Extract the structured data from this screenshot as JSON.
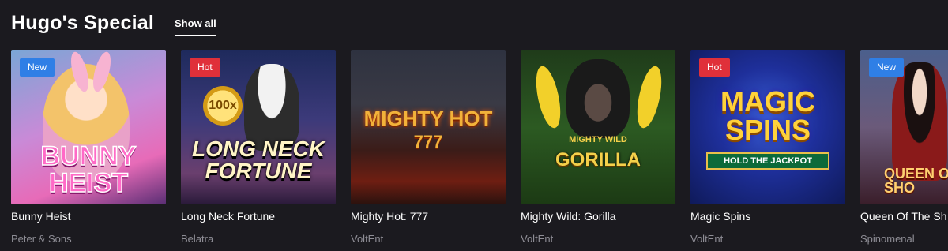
{
  "section": {
    "title": "Hugo's Special",
    "show_all_label": "Show all"
  },
  "games": [
    {
      "name": "Bunny Heist",
      "provider": "Peter & Sons",
      "badge": "New",
      "logo": "BUNNY HEIST"
    },
    {
      "name": "Long Neck Fortune",
      "provider": "Belatra",
      "badge": "Hot",
      "logo": "LONG NECK FORTUNE",
      "coin_text": "100x"
    },
    {
      "name": "Mighty Hot: 777",
      "provider": "VoltEnt",
      "badge": "",
      "logo": "MIGHTY HOT",
      "logo_sub": "777"
    },
    {
      "name": "Mighty Wild: Gorilla",
      "provider": "VoltEnt",
      "badge": "",
      "logo_top": "MIGHTY WILD",
      "logo": "GORILLA"
    },
    {
      "name": "Magic Spins",
      "provider": "VoltEnt",
      "badge": "Hot",
      "logo": "MAGIC SPINS",
      "logo_sub": "HOLD THE JACKPOT"
    },
    {
      "name": "Queen Of The Sh",
      "provider": "Spinomenal",
      "badge": "New",
      "logo": "QUEEN OF THE SHO"
    }
  ],
  "colors": {
    "background": "#1b1a1f",
    "badge_new": "#2f7fe6",
    "badge_hot": "#e0303a",
    "provider_text": "#8e8d95"
  }
}
